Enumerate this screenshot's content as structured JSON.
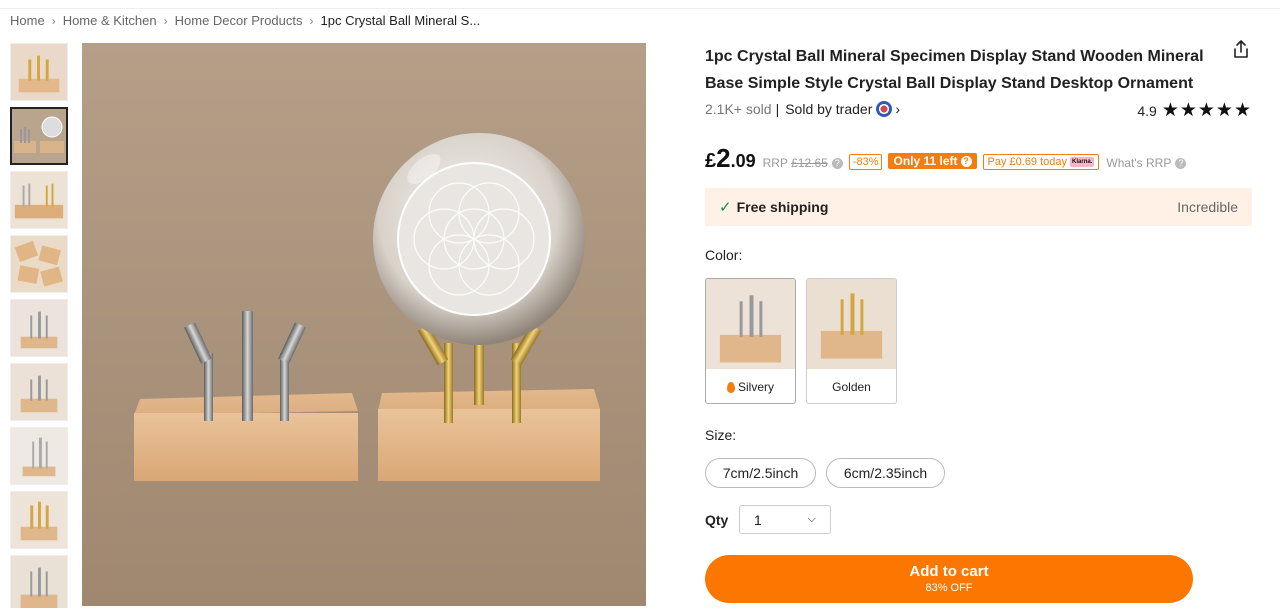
{
  "breadcrumb": [
    "Home",
    "Home & Kitchen",
    "Home Decor Products",
    "1pc Crystal Ball Mineral S..."
  ],
  "product": {
    "title": "1pc Crystal Ball Mineral Specimen Display Stand Wooden Mineral Base Simple Style Crystal Ball Display Stand Desktop Ornament",
    "sold": "2.1K+ sold",
    "sold_by": "Sold by trader",
    "rating": "4.9",
    "stars": "★★★★★"
  },
  "price": {
    "currency": "£",
    "integer": "2",
    "decimal": ".09",
    "rrp_label": "RRP",
    "rrp_value": "£12.65",
    "discount": "-83%",
    "stock": "Only 11 left",
    "klarna": "Pay £0.69 today",
    "klarna_badge": "Klarna.",
    "whats_rrp": "What's RRP"
  },
  "shipping": {
    "label": "Free shipping",
    "note": "Incredible"
  },
  "color": {
    "label": "Color:",
    "options": [
      "Silvery",
      "Golden"
    ]
  },
  "size": {
    "label": "Size:",
    "options": [
      "7cm/2.5inch",
      "6cm/2.35inch"
    ]
  },
  "qty": {
    "label": "Qty",
    "value": "1"
  },
  "cart": {
    "label": "Add to cart",
    "sub": "83% OFF"
  },
  "icons": {
    "share": "share-icon",
    "check": "check-icon",
    "help": "help-icon",
    "chevron": "chevron-down-icon"
  },
  "colors": {
    "accent": "#fb7701",
    "shipping_bg": "#fff1e6",
    "check_green": "#1a8a3c"
  }
}
